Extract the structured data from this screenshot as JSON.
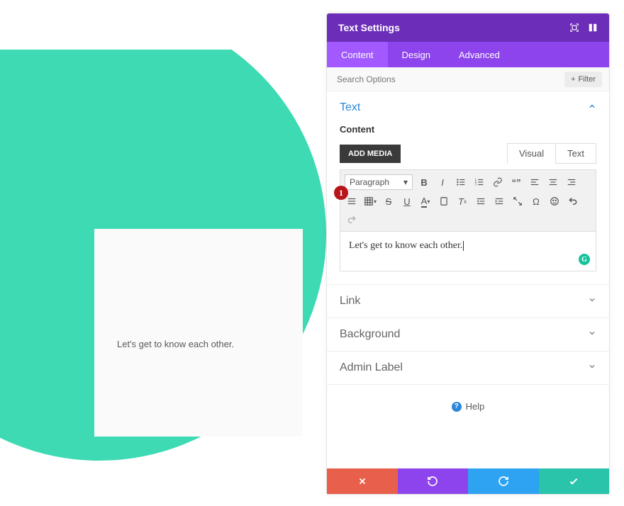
{
  "canvas": {
    "preview_text": "Let's get to know each other."
  },
  "panel": {
    "title": "Text Settings"
  },
  "tabs": {
    "content": "Content",
    "design": "Design",
    "advanced": "Advanced"
  },
  "search": {
    "placeholder": "Search Options",
    "filter_label": "Filter"
  },
  "sections": {
    "text": {
      "title": "Text",
      "content_label": "Content",
      "add_media": "ADD MEDIA",
      "visual_tab": "Visual",
      "text_tab": "Text",
      "paragraph_dropdown": "Paragraph",
      "editor_value": "Let's get to know each other."
    },
    "link": {
      "title": "Link"
    },
    "background": {
      "title": "Background"
    },
    "admin_label": {
      "title": "Admin Label"
    }
  },
  "help": {
    "label": "Help"
  },
  "annotation": {
    "num": "1"
  },
  "colors": {
    "teal": "#3ddab4",
    "purple_dark": "#6c2eb9",
    "purple": "#8e44ec",
    "purple_active": "#a259ff",
    "blue": "#2ea3f2",
    "green": "#29c4a9",
    "red": "#e8604c",
    "link_blue": "#2b87da"
  }
}
